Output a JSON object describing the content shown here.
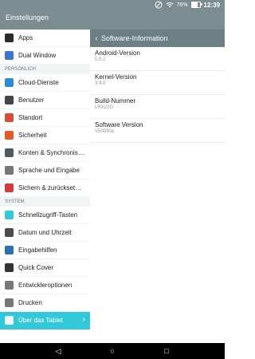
{
  "status": {
    "battery_pct": "76%",
    "time": "12:39"
  },
  "app": {
    "title": "Einstellungen"
  },
  "left": {
    "items": [
      {
        "label": "Apps",
        "icon": "apps-icon",
        "color": "#2b2b2b"
      },
      {
        "label": "Dual Window",
        "icon": "dual-window-icon",
        "color": "#3b77c9"
      },
      {
        "section": "PERSÖNLICH"
      },
      {
        "label": "Cloud-Dienste",
        "icon": "cloud-icon",
        "color": "#2a8bd8"
      },
      {
        "label": "Benutzer",
        "icon": "user-icon",
        "color": "#444444"
      },
      {
        "label": "Standort",
        "icon": "location-icon",
        "color": "#d74b3a"
      },
      {
        "label": "Sicherheit",
        "icon": "lock-icon",
        "color": "#e25b2b"
      },
      {
        "label": "Konten & Synchronis…",
        "icon": "sync-icon",
        "color": "#505a63"
      },
      {
        "label": "Sprache und Eingabe",
        "icon": "keyboard-icon",
        "color": "#777777"
      },
      {
        "label": "Sichern & zurückset…",
        "icon": "backup-icon",
        "color": "#d63b3b"
      },
      {
        "section": "SYSTEM"
      },
      {
        "label": "Schnellzugriff-Tasten",
        "icon": "shortcut-icon",
        "color": "#32c8da"
      },
      {
        "label": "Datum und Uhrzeit",
        "icon": "clock-icon",
        "color": "#4b4b4b"
      },
      {
        "label": "Eingabehilfen",
        "icon": "accessibility-icon",
        "color": "#2f6fb6"
      },
      {
        "label": "Quick Cover",
        "icon": "cover-icon",
        "color": "#333333"
      },
      {
        "label": "Entwickleroptionen",
        "icon": "developer-icon",
        "color": "#777777"
      },
      {
        "label": "Drucken",
        "icon": "print-icon",
        "color": "#777777"
      },
      {
        "label": "Über das Tablet",
        "icon": "tablet-icon",
        "color": "#e9f9fc",
        "active": true
      }
    ]
  },
  "right": {
    "header": {
      "back": "‹",
      "title": "Software-Information"
    },
    "entries": [
      {
        "title": "Android-Version",
        "value": "5.0.2"
      },
      {
        "title": "Kernel-Version",
        "value": "3.4.0"
      },
      {
        "title": "Build-Nummer",
        "value": "LRX22G"
      },
      {
        "title": "Software Version",
        "value": "V50030a"
      }
    ]
  },
  "navbar": {
    "back": "◁",
    "home": "○",
    "recent": "□"
  }
}
